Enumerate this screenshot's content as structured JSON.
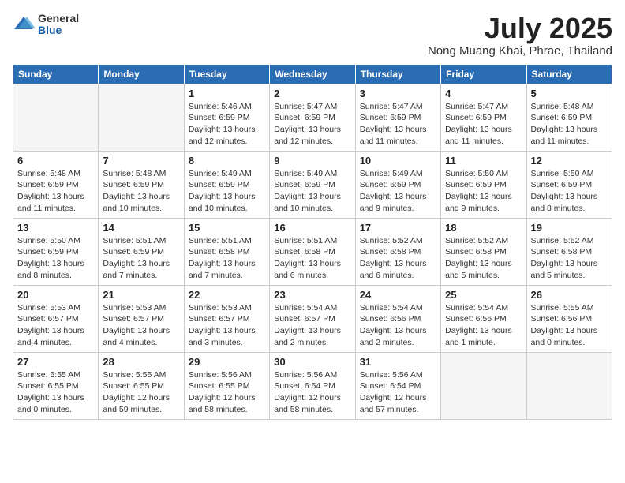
{
  "header": {
    "logo_general": "General",
    "logo_blue": "Blue",
    "month_title": "July 2025",
    "location": "Nong Muang Khai, Phrae, Thailand"
  },
  "columns": [
    "Sunday",
    "Monday",
    "Tuesday",
    "Wednesday",
    "Thursday",
    "Friday",
    "Saturday"
  ],
  "weeks": [
    [
      {
        "day": "",
        "info": ""
      },
      {
        "day": "",
        "info": ""
      },
      {
        "day": "1",
        "info": "Sunrise: 5:46 AM\nSunset: 6:59 PM\nDaylight: 13 hours\nand 12 minutes."
      },
      {
        "day": "2",
        "info": "Sunrise: 5:47 AM\nSunset: 6:59 PM\nDaylight: 13 hours\nand 12 minutes."
      },
      {
        "day": "3",
        "info": "Sunrise: 5:47 AM\nSunset: 6:59 PM\nDaylight: 13 hours\nand 11 minutes."
      },
      {
        "day": "4",
        "info": "Sunrise: 5:47 AM\nSunset: 6:59 PM\nDaylight: 13 hours\nand 11 minutes."
      },
      {
        "day": "5",
        "info": "Sunrise: 5:48 AM\nSunset: 6:59 PM\nDaylight: 13 hours\nand 11 minutes."
      }
    ],
    [
      {
        "day": "6",
        "info": "Sunrise: 5:48 AM\nSunset: 6:59 PM\nDaylight: 13 hours\nand 11 minutes."
      },
      {
        "day": "7",
        "info": "Sunrise: 5:48 AM\nSunset: 6:59 PM\nDaylight: 13 hours\nand 10 minutes."
      },
      {
        "day": "8",
        "info": "Sunrise: 5:49 AM\nSunset: 6:59 PM\nDaylight: 13 hours\nand 10 minutes."
      },
      {
        "day": "9",
        "info": "Sunrise: 5:49 AM\nSunset: 6:59 PM\nDaylight: 13 hours\nand 10 minutes."
      },
      {
        "day": "10",
        "info": "Sunrise: 5:49 AM\nSunset: 6:59 PM\nDaylight: 13 hours\nand 9 minutes."
      },
      {
        "day": "11",
        "info": "Sunrise: 5:50 AM\nSunset: 6:59 PM\nDaylight: 13 hours\nand 9 minutes."
      },
      {
        "day": "12",
        "info": "Sunrise: 5:50 AM\nSunset: 6:59 PM\nDaylight: 13 hours\nand 8 minutes."
      }
    ],
    [
      {
        "day": "13",
        "info": "Sunrise: 5:50 AM\nSunset: 6:59 PM\nDaylight: 13 hours\nand 8 minutes."
      },
      {
        "day": "14",
        "info": "Sunrise: 5:51 AM\nSunset: 6:59 PM\nDaylight: 13 hours\nand 7 minutes."
      },
      {
        "day": "15",
        "info": "Sunrise: 5:51 AM\nSunset: 6:58 PM\nDaylight: 13 hours\nand 7 minutes."
      },
      {
        "day": "16",
        "info": "Sunrise: 5:51 AM\nSunset: 6:58 PM\nDaylight: 13 hours\nand 6 minutes."
      },
      {
        "day": "17",
        "info": "Sunrise: 5:52 AM\nSunset: 6:58 PM\nDaylight: 13 hours\nand 6 minutes."
      },
      {
        "day": "18",
        "info": "Sunrise: 5:52 AM\nSunset: 6:58 PM\nDaylight: 13 hours\nand 5 minutes."
      },
      {
        "day": "19",
        "info": "Sunrise: 5:52 AM\nSunset: 6:58 PM\nDaylight: 13 hours\nand 5 minutes."
      }
    ],
    [
      {
        "day": "20",
        "info": "Sunrise: 5:53 AM\nSunset: 6:57 PM\nDaylight: 13 hours\nand 4 minutes."
      },
      {
        "day": "21",
        "info": "Sunrise: 5:53 AM\nSunset: 6:57 PM\nDaylight: 13 hours\nand 4 minutes."
      },
      {
        "day": "22",
        "info": "Sunrise: 5:53 AM\nSunset: 6:57 PM\nDaylight: 13 hours\nand 3 minutes."
      },
      {
        "day": "23",
        "info": "Sunrise: 5:54 AM\nSunset: 6:57 PM\nDaylight: 13 hours\nand 2 minutes."
      },
      {
        "day": "24",
        "info": "Sunrise: 5:54 AM\nSunset: 6:56 PM\nDaylight: 13 hours\nand 2 minutes."
      },
      {
        "day": "25",
        "info": "Sunrise: 5:54 AM\nSunset: 6:56 PM\nDaylight: 13 hours\nand 1 minute."
      },
      {
        "day": "26",
        "info": "Sunrise: 5:55 AM\nSunset: 6:56 PM\nDaylight: 13 hours\nand 0 minutes."
      }
    ],
    [
      {
        "day": "27",
        "info": "Sunrise: 5:55 AM\nSunset: 6:55 PM\nDaylight: 13 hours\nand 0 minutes."
      },
      {
        "day": "28",
        "info": "Sunrise: 5:55 AM\nSunset: 6:55 PM\nDaylight: 12 hours\nand 59 minutes."
      },
      {
        "day": "29",
        "info": "Sunrise: 5:56 AM\nSunset: 6:55 PM\nDaylight: 12 hours\nand 58 minutes."
      },
      {
        "day": "30",
        "info": "Sunrise: 5:56 AM\nSunset: 6:54 PM\nDaylight: 12 hours\nand 58 minutes."
      },
      {
        "day": "31",
        "info": "Sunrise: 5:56 AM\nSunset: 6:54 PM\nDaylight: 12 hours\nand 57 minutes."
      },
      {
        "day": "",
        "info": ""
      },
      {
        "day": "",
        "info": ""
      }
    ]
  ]
}
